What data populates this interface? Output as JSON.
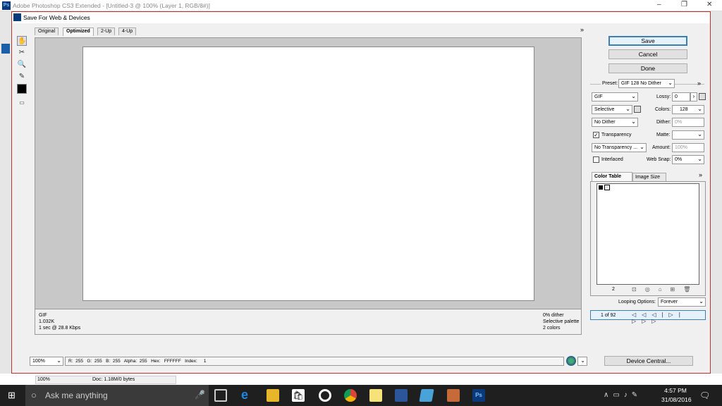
{
  "app": {
    "title": "Adobe Photoshop CS3 Extended - [Untitled-3 @ 100% (Layer 1, RGB/8#)]",
    "logo": "Ps"
  },
  "dialog": {
    "title": "Save For Web & Devices",
    "tabs": [
      "Original",
      "Optimized",
      "2-Up",
      "4-Up"
    ],
    "active_tab": "Optimized",
    "buttons": {
      "save": "Save",
      "cancel": "Cancel",
      "done": "Done"
    },
    "preset": {
      "label": "Preset:",
      "value": "GIF 128 No Dither"
    },
    "format": "GIF",
    "reduction": "Selective",
    "dither_algo": "No Dither",
    "transparency": {
      "label": "Transparency",
      "checked": true
    },
    "transparency_dither": "No Transparency ...",
    "interlaced": {
      "label": "Interlaced",
      "checked": false
    },
    "lossy": {
      "label": "Lossy:",
      "value": "0"
    },
    "colors": {
      "label": "Colors:",
      "value": "128"
    },
    "dither": {
      "label": "Dither:",
      "value": "0%"
    },
    "matte": {
      "label": "Matte:"
    },
    "amount": {
      "label": "Amount:",
      "value": "100%"
    },
    "web_snap": {
      "label": "Web Snap:",
      "value": "0%"
    },
    "panel_tabs": {
      "color_table": "Color Table",
      "image_size": "Image Size"
    },
    "color_count": "2",
    "looping": {
      "label": "Looping Options:",
      "value": "Forever"
    },
    "frame": "1 of 92",
    "info_left": [
      "GIF",
      "1.032K",
      "1 sec @ 28.8 Kbps"
    ],
    "info_right": [
      "0% dither",
      "Selective palette",
      "2 colors"
    ],
    "zoom": "100%",
    "readout": "R:  255   G:  255   B:  255   Alpha:  255   Hex:   FFFFFF   Index:     1",
    "device_central": "Device Central...",
    "more": "»"
  },
  "ps_status": {
    "zoom": "100%",
    "doc": "Doc: 1.18M/0 bytes"
  },
  "taskbar": {
    "search": "Ask me anything",
    "time": "4:57 PM",
    "date": "31/08/2016"
  }
}
